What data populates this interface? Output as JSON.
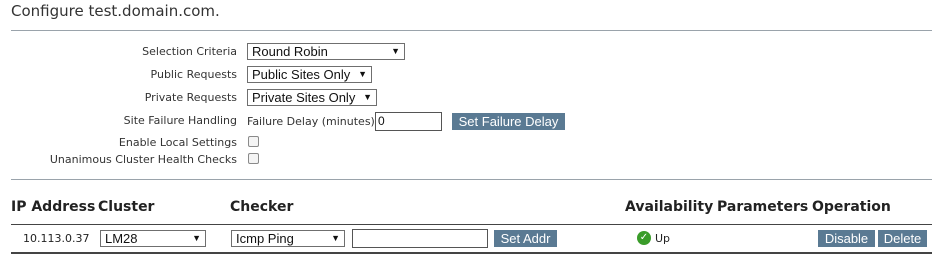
{
  "page": {
    "title": "Configure test.domain.com."
  },
  "settings": {
    "selection_criteria": {
      "label": "Selection Criteria",
      "value": "Round Robin"
    },
    "public_requests": {
      "label": "Public Requests",
      "value": "Public Sites Only"
    },
    "private_requests": {
      "label": "Private Requests",
      "value": "Private Sites Only"
    },
    "site_failure": {
      "label": "Site Failure Handling",
      "delay_label": "Failure Delay (minutes)",
      "delay_value": "0",
      "button": "Set Failure Delay"
    },
    "enable_local": {
      "label": "Enable Local Settings",
      "checked": false
    },
    "unanimous": {
      "label": "Unanimous Cluster Health Checks",
      "checked": false
    }
  },
  "table": {
    "headers": {
      "ip": "IP Address",
      "cluster": "Cluster",
      "checker": "Checker",
      "availability": "Availability",
      "parameters": "Parameters",
      "operation": "Operation"
    },
    "row": {
      "ip": "10.113.0.37",
      "cluster": "LM28",
      "checker": "Icmp Ping",
      "addr_value": "",
      "set_addr": "Set Addr",
      "availability": "Up",
      "disable": "Disable",
      "delete": "Delete"
    }
  },
  "colors": {
    "button": "#5a7a93",
    "status_up": "#3a9c2a",
    "divider": "#9aa3ab"
  }
}
